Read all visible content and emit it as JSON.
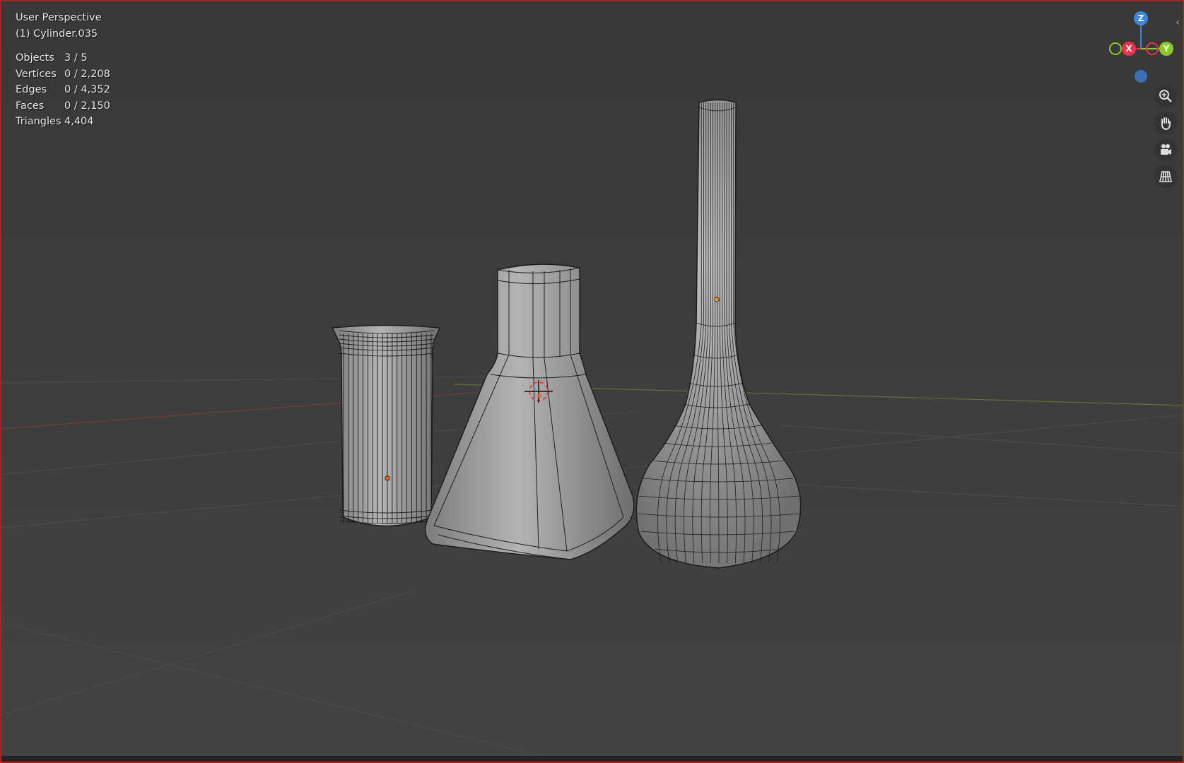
{
  "viewport": {
    "view_name": "User Perspective",
    "active_object": "(1) Cylinder.035",
    "stats": [
      {
        "label": "Objects",
        "value": "3 / 5"
      },
      {
        "label": "Vertices",
        "value": "0 / 2,208"
      },
      {
        "label": "Edges",
        "value": "0 / 4,352"
      },
      {
        "label": "Faces",
        "value": "0 / 2,150"
      },
      {
        "label": "Triangles",
        "value": "4,404"
      }
    ]
  },
  "gizmo": {
    "z_label": "Z",
    "x_label": "X",
    "y_label": "Y",
    "colors": {
      "x": "#e8334a",
      "y": "#8bc926",
      "z": "#3b87e0"
    }
  },
  "nav_icons": [
    "zoom-icon",
    "hand-pan-icon",
    "camera-icon",
    "grid-ortho-icon"
  ],
  "colors": {
    "background": "#3d3d3d",
    "mesh_fill": "#9b9b9b",
    "wire": "#1c1c1c",
    "origin_dot": "#e8632a",
    "border": "#b11e1e"
  }
}
